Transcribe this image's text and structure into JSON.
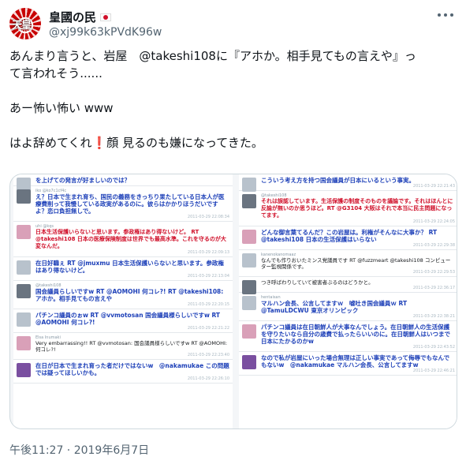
{
  "user": {
    "display_name": "皇國の民",
    "handle": "@xj99k63kPVdK96w",
    "avatar_text": "天皇"
  },
  "tweet": {
    "line1": "あんまり言うと、岩屋　@takeshi108に『アホか。相手見てもの言えや』っ",
    "line2": "て言われそう......",
    "line3": "あー怖い怖い www",
    "line4a": "はよ辞めてくれ",
    "line4_emoji": "❗",
    "line4b": "顔 見るのも嫌になってきた。"
  },
  "media": {
    "left": [
      {
        "user": "",
        "body": "を上げての発言が好ましいのでは？",
        "style": "blue",
        "meta": ""
      },
      {
        "user": "iko @ko7c1cf4c",
        "body": "え？日本で生まれ育ち、国民の義務をきっちり果たしている日本人が医療費削って我慢している政実があるのに。彼らはかかりほうだいですよ？恋ロ負担無しで。",
        "style": "blue",
        "meta": "2011-03-29 22:08:34"
      },
      {
        "user": "uhi @kqs",
        "body": "日本生活保護いらないと思います。参政権はあり得ないけど。 RT @takeshi108 日本の医療保険制度は世界でも最高水準。これを守るのが大変なんだ。",
        "style": "red",
        "meta": "2011-03-29 22:09:13"
      },
      {
        "user": "",
        "body": "在日好職ぇ RT @jmuxmu 日本生活保護いらないと思います。参政権はあり得ないけど。",
        "style": "blue",
        "meta": "2011-03-29 22:13:04"
      },
      {
        "user": "@takeshi108",
        "body": "国会議員らしいですw RT @AOMOHI 何コレ?! RT @takeshi108: アホか。相手見てもの言えや",
        "style": "blue",
        "meta": "2011-03-29 22:20:15"
      },
      {
        "user": "",
        "body": "パチンコ議員のぉw RT @vvmotosan 国会議員様らしいですw RT @AOMOHI 何コレ?!",
        "style": "blue",
        "meta": "2011-03-29 22:21:22"
      },
      {
        "user": "Elsa Inumaki",
        "body": "Very embarrassing!! RT @vvmotosan: 国会議員様らしいですw RT @AOMOHI: 何コレ?!",
        "style": "",
        "meta": "2011-03-29 22:23:40"
      },
      {
        "user": "",
        "body": "在日が日本で生まれ育った者だけではないw　@nakamukae この問題では疑ってほしいかも。",
        "style": "blue",
        "meta": "2011-03-29 22:26:10"
      }
    ],
    "right": [
      {
        "user": "",
        "body": "こういう考え方を持つ国会議員が日本にいるという事実。",
        "style": "blue",
        "meta": "2011-03-29 22:21:43"
      },
      {
        "user": "@takeshi108",
        "body": "それは誤認しています。生活保護の制度そのものを議論です。それはほんとに反論が無いのか思うほど。RT @G3104 大阪はそれで本当に民主問題になってます。",
        "style": "red",
        "meta": "2011-03-29 22:24:05"
      },
      {
        "user": "",
        "body": "どんな御言葉てるんだ？この岩屋は。利権がそんなに大事か？ RT @takeshi108 日本の生活保護はいらない",
        "style": "blue",
        "meta": "2011-03-29 22:29:38"
      },
      {
        "user": "kanenokanomaaz",
        "body": "なんでも作りおいたミンス党議員です RT @fuzzmeart @takeshi108 コンピューター監視関係です。",
        "style": "",
        "meta": "2011-03-29 22:29:53"
      },
      {
        "user": "",
        "body": "つき呼ばわりしていて被害者ぶるのはどうかと。",
        "style": "",
        "meta": "2011-03-29 22:36:17"
      },
      {
        "user": "hentaisan",
        "body": "マルハン会長、公言してますｗ　嘘吐き国会議員ｗ RT @TamuLDCWU 東京オリンピック",
        "style": "blue",
        "meta": "2011-03-29 22:38:21"
      },
      {
        "user": "",
        "body": "パチンコ議員は在日朝鮮人が大事なんでしょう。在日朝鮮人の生活保護を守りたいなら自分の歳費で払ったらいいのに。在日朝鮮人はいつまで日本にたかるのかw",
        "style": "blue",
        "meta": "2011-03-29 22:43:52"
      },
      {
        "user": "",
        "body": "なので私が岩屋にいった場合無理は正しい事実であって侮辱でもなんでもないw　@nakamukae マルハン会長、公言してますw",
        "style": "blue",
        "meta": "2011-03-29 22:46:21"
      }
    ]
  },
  "timestamp": "午後11:27 · 2019年6月7日",
  "colors": {
    "text": "#0f1419",
    "secondary": "#536471",
    "accent_blue": "#1c3fb8",
    "accent_red": "#d0102a"
  }
}
